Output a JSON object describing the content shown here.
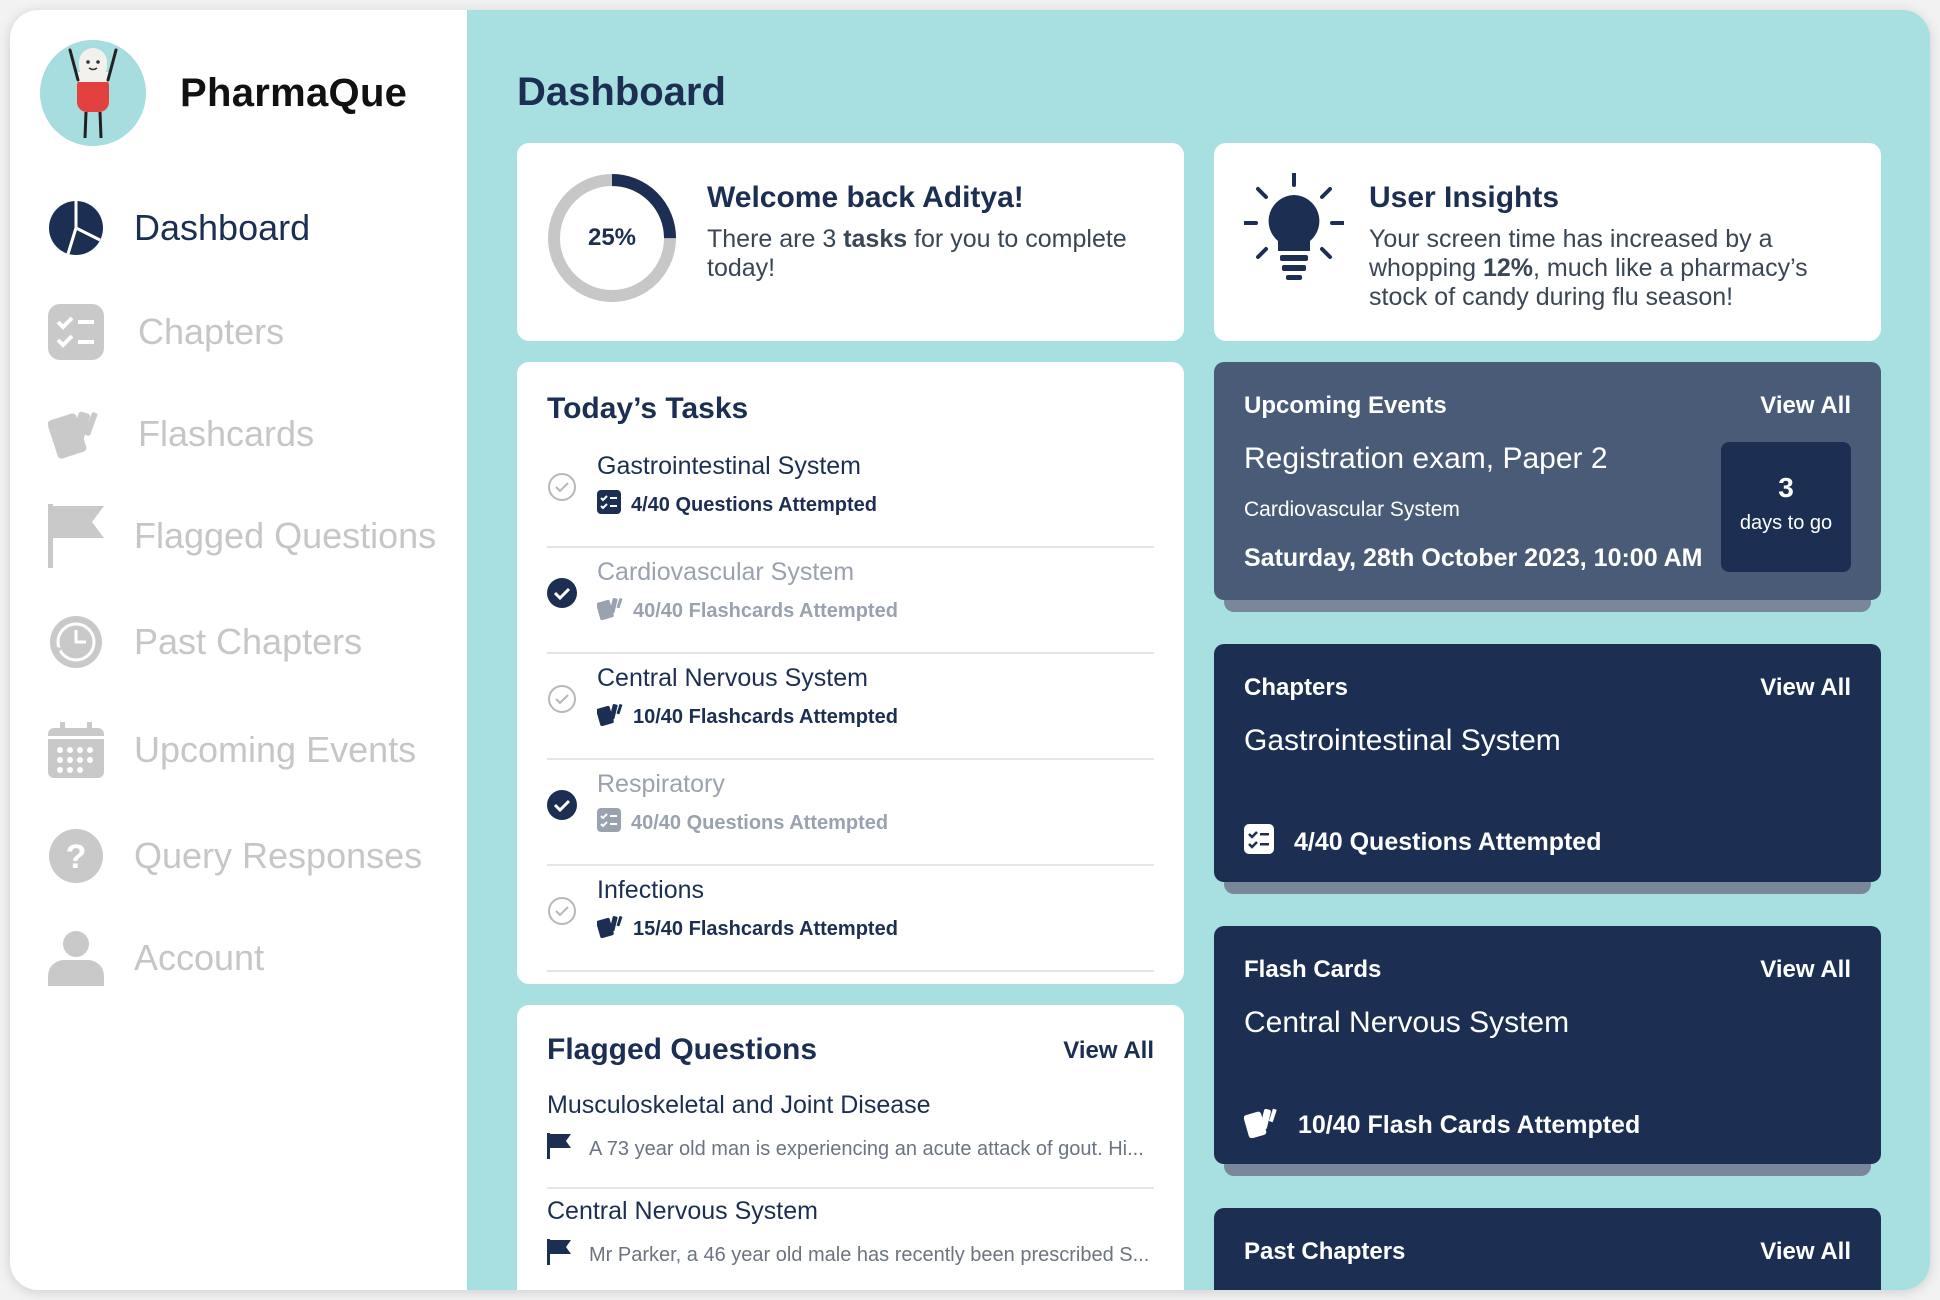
{
  "brand": {
    "name": "PharmaQue"
  },
  "sidebar": {
    "items": [
      {
        "label": "Dashboard",
        "icon": "pie-chart-icon",
        "active": true
      },
      {
        "label": "Chapters",
        "icon": "checklist-icon"
      },
      {
        "label": "Flashcards",
        "icon": "cards-icon"
      },
      {
        "label": "Flagged Questions",
        "icon": "flag-icon"
      },
      {
        "label": "Past Chapters",
        "icon": "history-icon"
      },
      {
        "label": "Upcoming Events",
        "icon": "calendar-icon"
      },
      {
        "label": "Query Responses",
        "icon": "question-icon"
      },
      {
        "label": "Account",
        "icon": "user-icon"
      }
    ]
  },
  "page": {
    "title": "Dashboard"
  },
  "welcome": {
    "progress_label": "25%",
    "progress": 0.25,
    "title": "Welcome back Aditya!",
    "text_pre": "There are 3 ",
    "text_bold": "tasks",
    "text_post": " for you to complete today!"
  },
  "insights": {
    "title": "User Insights",
    "text_pre": "Your screen time has increased by a whopping ",
    "text_bold": "12%",
    "text_post": ", much like a pharmacy’s stock of candy during flu season!"
  },
  "tasks": {
    "title": "Today’s Tasks",
    "items": [
      {
        "title": "Gastrointestinal System",
        "sub": "4/40 Questions Attempted",
        "done": false,
        "kind": "questions"
      },
      {
        "title": "Cardiovascular System",
        "sub": "40/40 Flashcards Attempted",
        "done": true,
        "kind": "flashcards"
      },
      {
        "title": "Central Nervous System",
        "sub": "10/40 Flashcards Attempted",
        "done": false,
        "kind": "flashcards"
      },
      {
        "title": "Respiratory",
        "sub": "40/40 Questions Attempted",
        "done": true,
        "kind": "questions"
      },
      {
        "title": "Infections",
        "sub": "15/40 Flashcards Attempted",
        "done": false,
        "kind": "flashcards"
      }
    ]
  },
  "flagged": {
    "title": "Flagged Questions",
    "view_all": "View All",
    "items": [
      {
        "title": "Musculoskeletal and Joint Disease",
        "preview": "A 73 year old man is experiencing an acute attack of gout. Hi..."
      },
      {
        "title": "Central Nervous System",
        "preview": "Mr Parker, a 46 year old male has recently been prescribed S..."
      }
    ]
  },
  "events": {
    "heading": "Upcoming Events",
    "view_all": "View All",
    "title": "Registration exam, Paper 2",
    "subtitle": "Cardiovascular System",
    "date": "Saturday, 28th October 2023, 10:00 AM",
    "days": "3",
    "days_label": "days to go"
  },
  "chapters": {
    "heading": "Chapters",
    "view_all": "View All",
    "title": "Gastrointestinal System",
    "foot": "4/40 Questions Attempted"
  },
  "flashcards": {
    "heading": "Flash Cards",
    "view_all": "View All",
    "title": "Central Nervous System",
    "foot": "10/40 Flash Cards Attempted"
  },
  "past": {
    "heading": "Past Chapters",
    "view_all": "View All"
  },
  "colors": {
    "navy": "#1c2f52",
    "slate": "#4a5b78",
    "teal_bg": "#a8e0e1",
    "muted": "#c6c6c6"
  }
}
